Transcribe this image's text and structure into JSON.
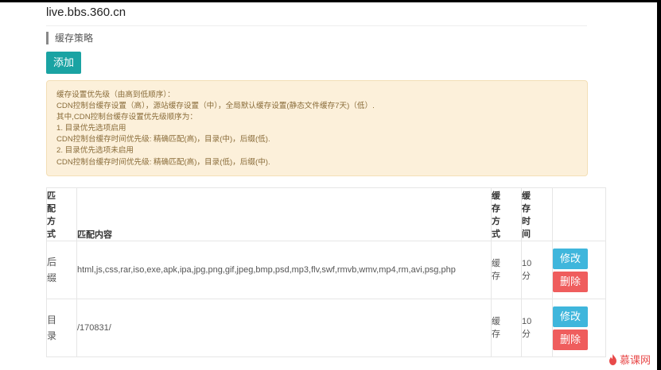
{
  "header": {
    "domain": "live.bbs.360.cn"
  },
  "section": {
    "title": "缓存策略"
  },
  "toolbar": {
    "add_label": "添加"
  },
  "notice": {
    "lines": [
      "缓存设置优先级（由高到低顺序）：",
      "CDN控制台缓存设置（高），源站缓存设置（中），全局默认缓存设置(静态文件缓存7天)（低）.",
      "其中,CDN控制台缓存设置优先级顺序为：",
      "1. 目录优先选项启用",
      "CDN控制台缓存时间优先级: 精确匹配(高)，目录(中)，后缀(低).",
      "2. 目录优先选项未启用",
      "CDN控制台缓存时间优先级: 精确匹配(高)，目录(低)，后缀(中)."
    ]
  },
  "table": {
    "headers": {
      "match_type": "匹配方式",
      "match_content": "匹配内容",
      "cache_mode": "缓存方式",
      "cache_time": "缓存时间"
    },
    "rows": [
      {
        "match_type": "后缀",
        "match_content": "html,js,css,rar,iso,exe,apk,ipa,jpg,png,gif,jpeg,bmp,psd,mp3,flv,swf,rmvb,wmv,mp4,rm,avi,psg,php",
        "cache_mode": "缓存",
        "cache_time": "10分",
        "edit_label": "修改",
        "delete_label": "删除"
      },
      {
        "match_type": "目录",
        "match_content": "/170831/",
        "cache_mode": "缓存",
        "cache_time": "10分",
        "edit_label": "修改",
        "delete_label": "删除"
      }
    ]
  },
  "watermark": {
    "text": "慕课网",
    "icon": "flame-icon",
    "color": "#e84a4a"
  },
  "colors": {
    "add_button": "#1aa3a3",
    "edit_button": "#3fb6dc",
    "delete_button": "#ef5d5d",
    "notice_bg": "#fcf0da",
    "notice_text": "#8a6d3b"
  }
}
